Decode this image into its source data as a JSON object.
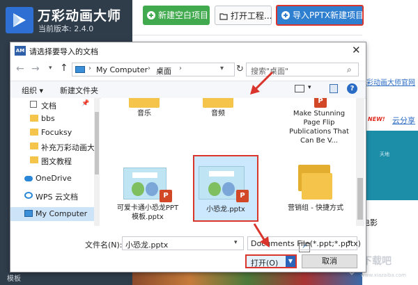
{
  "app": {
    "name": "万彩动画大师",
    "version": "当前版本: 2.4.0",
    "toolbar": {
      "new_project": "新建空白项目",
      "open_project": "打开工程...",
      "import_ppt": "导入PPTX新建项目"
    },
    "right_panel": {
      "link": "彩动画大师官网",
      "new_badge": "NEW!",
      "cloud_share": "云分享",
      "thumb_text": "天地",
      "movie_label": "电影"
    },
    "watermark": "下载吧",
    "watermark_url": "www.xiazaiba.com",
    "sidebar_bottom": "模板"
  },
  "dialog": {
    "title": "请选择要导入的文档",
    "title_icon": "AM",
    "address": {
      "segments": [
        "My Computer",
        "桌面"
      ]
    },
    "search_placeholder": "搜索\"桌面\"",
    "toolbar": {
      "organize": "组织 ▾",
      "new_folder": "新建文件夹"
    },
    "nav_tree": [
      {
        "label": "文档",
        "icon": "document-icon"
      },
      {
        "label": "bbs",
        "icon": "folder-icon"
      },
      {
        "label": "Focuksy",
        "icon": "folder-icon"
      },
      {
        "label": "补充万彩动画大师",
        "icon": "folder-icon"
      },
      {
        "label": "图文教程",
        "icon": "folder-icon"
      },
      {
        "label": "OneDrive",
        "icon": "onedrive-icon"
      },
      {
        "label": "WPS 云文档",
        "icon": "wps-cloud-icon"
      },
      {
        "label": "My Computer",
        "icon": "computer-icon",
        "selected": true
      }
    ],
    "files": [
      {
        "name": "音乐",
        "type": "folder"
      },
      {
        "name": "音频",
        "type": "folder"
      },
      {
        "name": "Make Stunning Page Flip Publications That Can Be V...",
        "type": "ppt"
      },
      {
        "name": "可爱卡通小恐龙PPT模板.pptx",
        "type": "ppt"
      },
      {
        "name": "小恐龙.pptx",
        "type": "ppt",
        "selected": true
      },
      {
        "name": "营销组 - 快捷方式",
        "type": "shortcut-folder"
      }
    ],
    "filename_label": "文件名(N):",
    "filename_value": "小恐龙.pptx",
    "filetype_value": "Documents File(*.ppt;*.pptx)",
    "open_button": "打开(O)",
    "cancel_button": "取消"
  },
  "colors": {
    "sidebar_bg": "#2f3c4a",
    "accent_blue": "#2f7fd0",
    "green": "#41a94e",
    "highlight_red": "#d9352c",
    "selection": "#cce8ff"
  }
}
